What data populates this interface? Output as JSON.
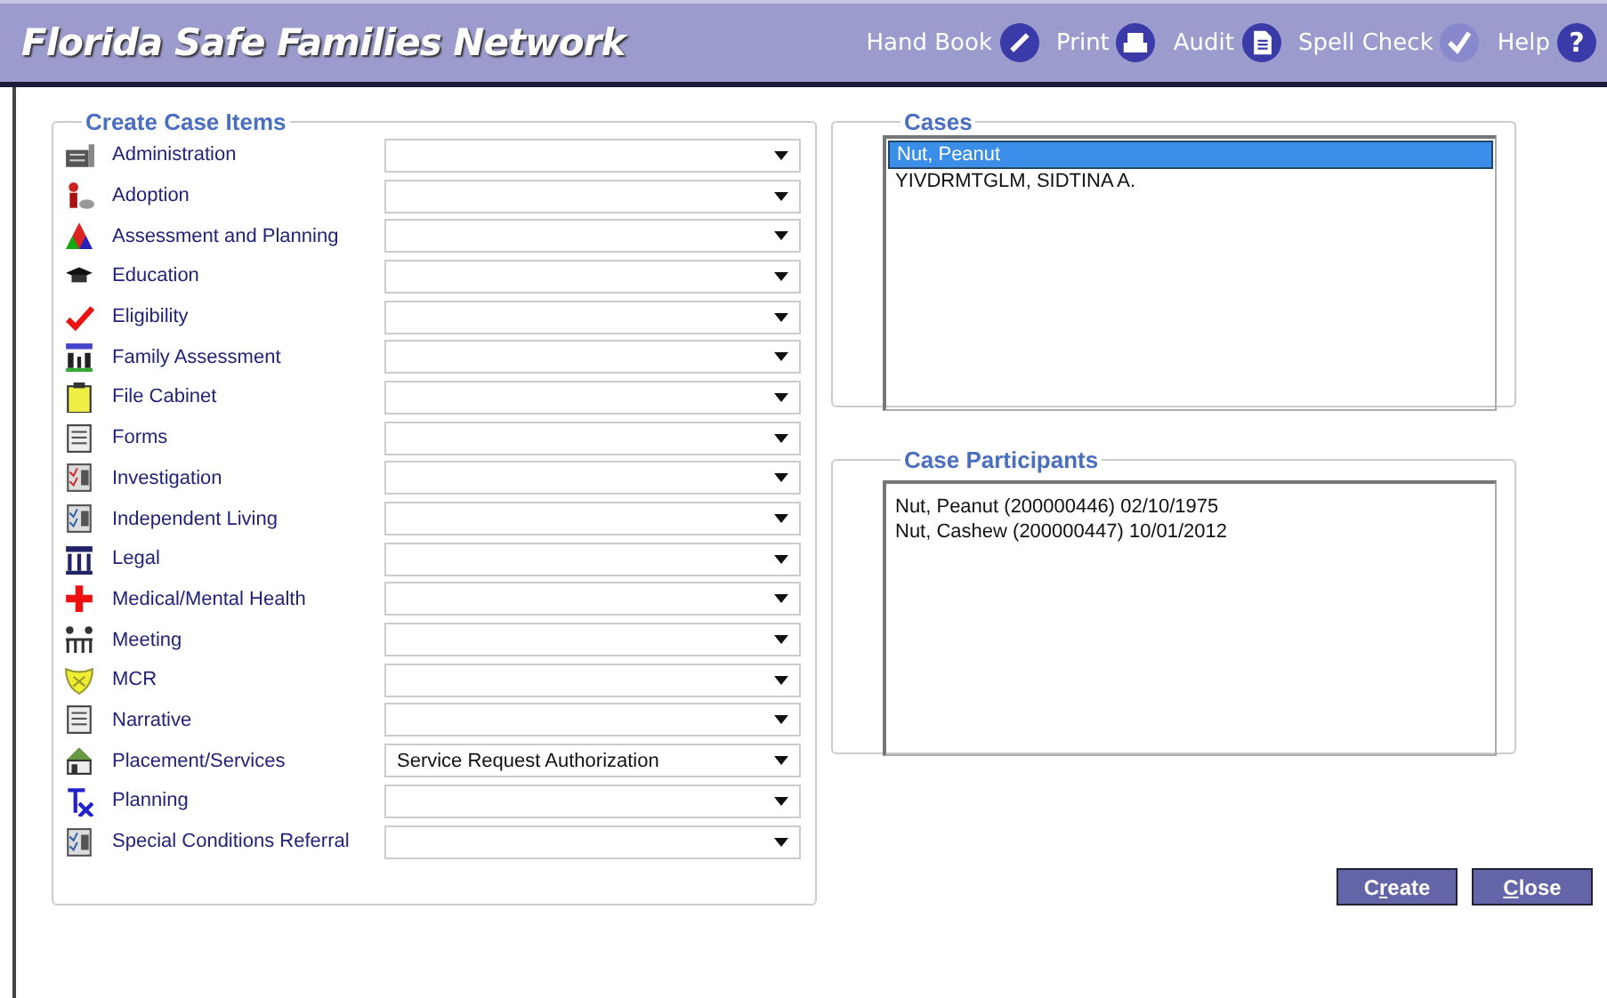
{
  "header": {
    "title": "Florida Safe Families Network",
    "tools": [
      {
        "label": "Hand Book"
      },
      {
        "label": "Print"
      },
      {
        "label": "Audit"
      },
      {
        "label": "Spell Check"
      },
      {
        "label": "Help",
        "glyph": "?"
      }
    ]
  },
  "create_case_items": {
    "title": "Create Case Items",
    "items": [
      {
        "label": "Administration"
      },
      {
        "label": "Adoption"
      },
      {
        "label": "Assessment and Planning"
      },
      {
        "label": "Education"
      },
      {
        "label": "Eligibility"
      },
      {
        "label": "Family Assessment"
      },
      {
        "label": "File Cabinet"
      },
      {
        "label": "Forms"
      },
      {
        "label": "Investigation"
      },
      {
        "label": "Independent Living"
      },
      {
        "label": "Legal"
      },
      {
        "label": "Medical/Mental Health"
      },
      {
        "label": "Meeting"
      },
      {
        "label": "MCR"
      },
      {
        "label": "Narrative"
      },
      {
        "label": "Placement/Services",
        "value": "Service Request Authorization"
      },
      {
        "label": "Planning"
      },
      {
        "label": "Special Conditions Referral"
      }
    ]
  },
  "cases": {
    "title": "Cases",
    "items": [
      {
        "text": "Nut, Peanut",
        "selected": true
      },
      {
        "text": "YIVDRMTGLM, SIDTINA A.",
        "selected": false
      }
    ]
  },
  "case_participants": {
    "title": "Case Participants",
    "items": [
      {
        "text": "Nut, Peanut (200000446) 02/10/1975"
      },
      {
        "text": "Nut, Cashew (200000447) 10/01/2012"
      }
    ]
  },
  "buttons": [
    {
      "before": "C",
      "mnemonic": "r",
      "after": "eate"
    },
    {
      "mnemonic": "C",
      "after": "lose"
    }
  ]
}
